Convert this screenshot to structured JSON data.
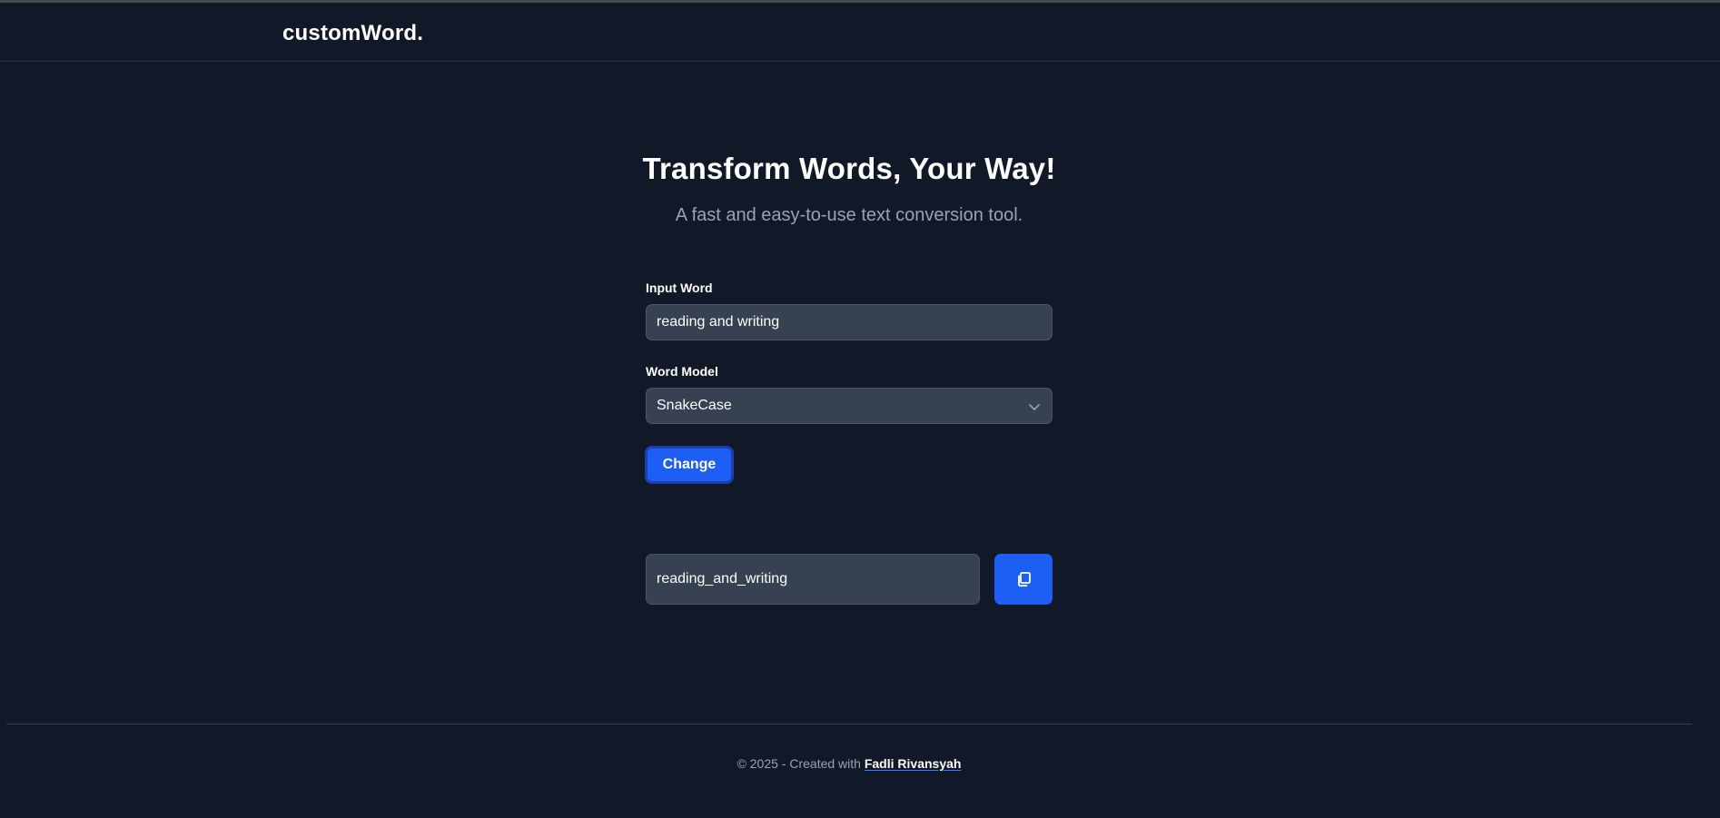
{
  "navbar": {
    "brand": "customWord."
  },
  "hero": {
    "title": "Transform Words, Your Way!",
    "subtitle": "A fast and easy-to-use text conversion tool."
  },
  "form": {
    "input_label": "Input Word",
    "input_value": "reading and writing",
    "model_label": "Word Model",
    "model_selected": "SnakeCase",
    "change_label": "Change"
  },
  "output": {
    "value": "reading_and_writing",
    "copy_icon": "copy-icon"
  },
  "footer": {
    "prefix": "© 2025 - Created with ",
    "author": "Fadli Rivansyah"
  },
  "colors": {
    "background": "#111827",
    "field": "#374151",
    "accent": "#1d5ff5",
    "muted_text": "#9ca3af"
  }
}
